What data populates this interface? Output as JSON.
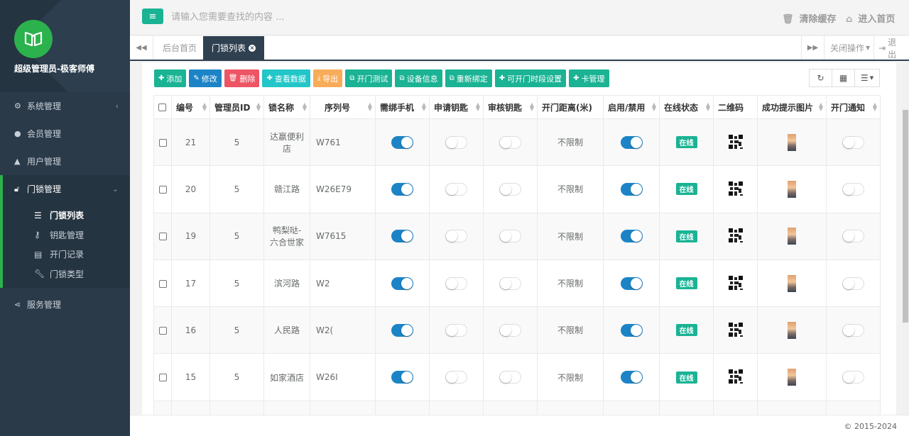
{
  "sidebar": {
    "title": "超级管理员-极客师傅",
    "menu": [
      {
        "label": "系统管理",
        "icon": "gears-icon"
      },
      {
        "label": "会员管理",
        "icon": "users-icon"
      },
      {
        "label": "用户管理",
        "icon": "user-icon"
      },
      {
        "label": "门锁管理",
        "icon": "unlock-icon"
      }
    ],
    "submenu": [
      {
        "label": "门锁列表",
        "icon": "list-icon"
      },
      {
        "label": "钥匙管理",
        "icon": "key-icon"
      },
      {
        "label": "开门记录",
        "icon": "table-icon"
      },
      {
        "label": "门锁类型",
        "icon": "wrench-icon"
      }
    ],
    "service": {
      "label": "服务管理",
      "icon": "share-icon"
    }
  },
  "topbar": {
    "search_placeholder": "请输入您需要查找的内容 ...",
    "clear_cache": "清除缓存",
    "home": "进入首页"
  },
  "tabs": {
    "home": "后台首页",
    "current": "门锁列表",
    "close_ops": "关闭操作",
    "logout": "退出"
  },
  "toolbar": {
    "add": "添加",
    "edit": "修改",
    "delete": "删除",
    "view": "查看数据",
    "export": "导出",
    "open_test": "开门测试",
    "device_info": "设备信息",
    "rebind": "重新绑定",
    "time_settings": "可开门时段设置",
    "card_mgmt": "卡管理"
  },
  "table": {
    "headers": [
      "编号",
      "管理员ID",
      "锁名称",
      "序列号",
      "需绑手机",
      "申请钥匙",
      "审核钥匙",
      "开门距离(米)",
      "启用/禁用",
      "在线状态",
      "二维码",
      "成功提示图片",
      "开门通知"
    ],
    "rows": [
      {
        "id": "21",
        "admin": "5",
        "name": "达嬴便利店",
        "serial": "W761",
        "phone": true,
        "apply": false,
        "audit": false,
        "distance": "不限制",
        "enabled": true,
        "status": "在线",
        "notify": false
      },
      {
        "id": "20",
        "admin": "5",
        "name": "赣江路",
        "serial": "W26E79",
        "phone": true,
        "apply": false,
        "audit": false,
        "distance": "不限制",
        "enabled": true,
        "status": "在线",
        "notify": false
      },
      {
        "id": "19",
        "admin": "5",
        "name": "鸭梨哒-六合世家",
        "serial": "W7615",
        "phone": true,
        "apply": false,
        "audit": false,
        "distance": "不限制",
        "enabled": true,
        "status": "在线",
        "notify": false
      },
      {
        "id": "17",
        "admin": "5",
        "name": "滨河路",
        "serial": "W2",
        "phone": true,
        "apply": false,
        "audit": false,
        "distance": "不限制",
        "enabled": true,
        "status": "在线",
        "notify": false
      },
      {
        "id": "16",
        "admin": "5",
        "name": "人民路",
        "serial": "W2(",
        "phone": true,
        "apply": false,
        "audit": false,
        "distance": "不限制",
        "enabled": true,
        "status": "在线",
        "notify": false
      },
      {
        "id": "15",
        "admin": "5",
        "name": "如家酒店",
        "serial": "W26I",
        "phone": true,
        "apply": false,
        "audit": false,
        "distance": "不限制",
        "enabled": true,
        "status": "在线",
        "notify": false
      }
    ]
  },
  "footer": {
    "copyright": "© 2015-2024"
  },
  "colors": {
    "primary": "#1ab394",
    "blue": "#1c84c6",
    "red": "#ed5565",
    "cyan": "#23c6c8",
    "orange": "#f8ac59",
    "sidebar": "#2b3a49"
  }
}
